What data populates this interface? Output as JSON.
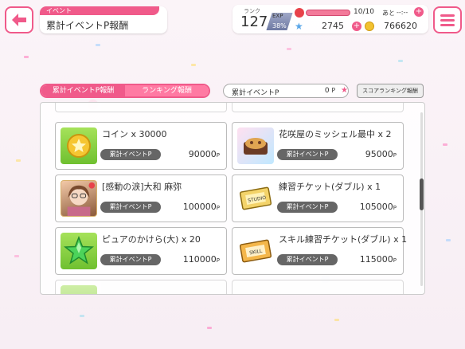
{
  "header": {
    "tag": "イベント",
    "title": "累計イベントP報酬"
  },
  "status": {
    "rank_label": "ランク",
    "rank": "127",
    "exp_label": "EXP",
    "exp_percent": "38%",
    "life": "10/10",
    "life_ato": "あと",
    "life_time": "--:--",
    "gems": "2745",
    "coins": "766620",
    "plus": "+"
  },
  "tabs": [
    {
      "label": "累計イベントP報酬",
      "active": true
    },
    {
      "label": "ランキング報酬",
      "active": false
    }
  ],
  "points_box": {
    "label": "累計イベントP",
    "value": "0",
    "unit": "P"
  },
  "score_button": "スコアランキング報酬",
  "rewards": [
    {
      "name": "コイン x 30000",
      "pill": "累計イベントP",
      "points": "90000",
      "unit": "P",
      "icon": "coin-icon"
    },
    {
      "name": "花咲屋のミッシェル最中 x 2",
      "pill": "累計イベントP",
      "points": "95000",
      "unit": "P",
      "icon": "misshel-monaka-icon"
    },
    {
      "name": "[感動の涙]大和 麻弥",
      "pill": "累計イベントP",
      "points": "100000",
      "unit": "P",
      "icon": "card-portrait-icon"
    },
    {
      "name": "練習チケット(ダブル) x 1",
      "pill": "累計イベントP",
      "points": "105000",
      "unit": "P",
      "icon": "studio-ticket-icon"
    },
    {
      "name": "ピュアのかけら(大) x 20",
      "pill": "累計イベントP",
      "points": "110000",
      "unit": "P",
      "icon": "green-star-icon"
    },
    {
      "name": "スキル練習チケット(ダブル) x 1",
      "pill": "累計イベントP",
      "points": "115000",
      "unit": "P",
      "icon": "skill-ticket-icon"
    }
  ],
  "colors": {
    "accent": "#f05a8a",
    "pill": "#666666"
  }
}
